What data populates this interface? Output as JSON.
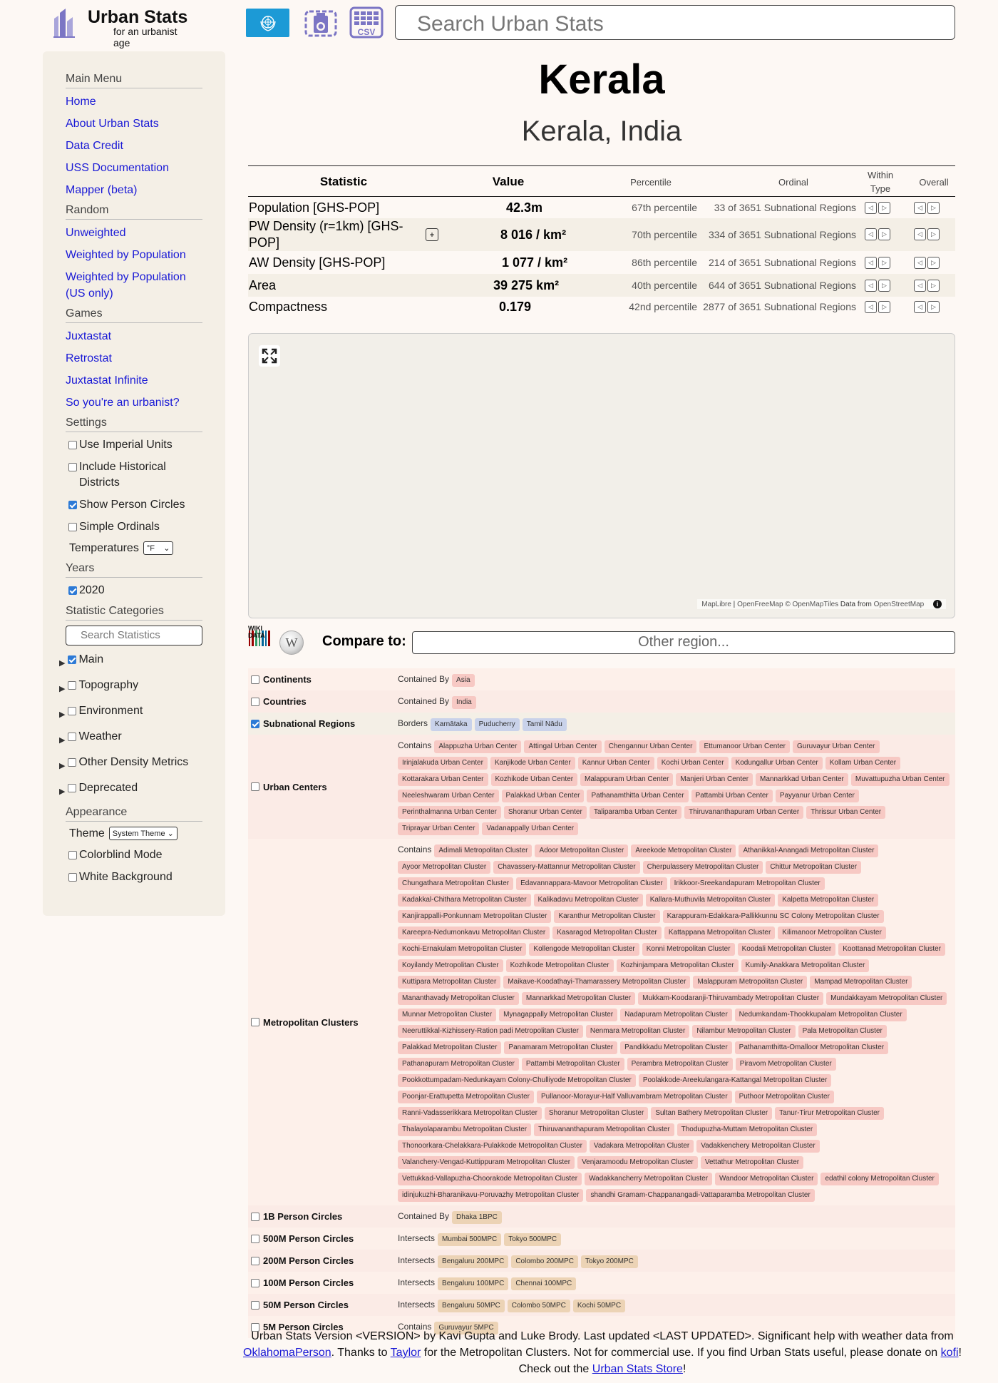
{
  "header": {
    "logo_title": "Urban Stats",
    "logo_subtitle": "for an urbanist age",
    "search_placeholder": "Search Urban Stats",
    "csv_label": "CSV",
    "accent": "#1c9ad6",
    "icon_color": "#7b75c4"
  },
  "sidebar": {
    "main_menu": {
      "title": "Main Menu",
      "items": [
        "Home",
        "About Urban Stats",
        "Data Credit",
        "USS Documentation",
        "Mapper (beta)"
      ]
    },
    "random": {
      "title": "Random",
      "items": [
        "Unweighted",
        "Weighted by Population",
        "Weighted by Population (US only)"
      ]
    },
    "games": {
      "title": "Games",
      "items": [
        "Juxtastat",
        "Retrostat",
        "Juxtastat Infinite",
        "So you're an urbanist?"
      ]
    },
    "settings": {
      "title": "Settings",
      "checks": [
        {
          "label": "Use Imperial Units",
          "checked": false
        },
        {
          "label": "Include Historical Districts",
          "checked": false
        },
        {
          "label": "Show Person Circles",
          "checked": true
        },
        {
          "label": "Simple Ordinals",
          "checked": false
        }
      ],
      "temperatures_label": "Temperatures",
      "temperatures_value": "°F"
    },
    "years": {
      "title": "Years",
      "checks": [
        {
          "label": "2020",
          "checked": true
        }
      ]
    },
    "categories": {
      "title": "Statistic Categories",
      "search_placeholder": "Search Statistics",
      "items": [
        {
          "label": "Main",
          "checked": true
        },
        {
          "label": "Topography",
          "checked": false
        },
        {
          "label": "Environment",
          "checked": false
        },
        {
          "label": "Weather",
          "checked": false
        },
        {
          "label": "Other Density Metrics",
          "checked": false
        },
        {
          "label": "Deprecated",
          "checked": false
        }
      ]
    },
    "appearance": {
      "title": "Appearance",
      "theme_label": "Theme",
      "theme_value": "System Theme",
      "checks": [
        {
          "label": "Colorblind Mode",
          "checked": false
        },
        {
          "label": "White Background",
          "checked": false
        }
      ]
    }
  },
  "page": {
    "title": "Kerala",
    "subtitle": "Kerala, India"
  },
  "stats": {
    "headers": {
      "statistic": "Statistic",
      "value": "Value",
      "percentile": "Percentile",
      "ordinal": "Ordinal",
      "within_type": "Within Type",
      "overall": "Overall"
    },
    "rows": [
      {
        "name": "Population [GHS-POP]",
        "value": "42.3m",
        "percentile": "67th percentile",
        "ordinal": "33 of 3651 Subnational Regions"
      },
      {
        "name": "PW Density (r=1km) [GHS-POP]",
        "value": "8 016 / km²",
        "percentile": "70th percentile",
        "ordinal": "334 of 3651 Subnational Regions"
      },
      {
        "name": "AW Density [GHS-POP]",
        "value": "1 077 / km²",
        "percentile": "86th percentile",
        "ordinal": "214 of 3651 Subnational Regions"
      },
      {
        "name": "Area",
        "value": "39 275 km²",
        "percentile": "40th percentile",
        "ordinal": "644 of 3651 Subnational Regions"
      },
      {
        "name": "Compactness",
        "value": "0.179",
        "percentile": "42nd percentile",
        "ordinal": "2877 of 3651 Subnational Regions"
      }
    ]
  },
  "map": {
    "attribution_maplibre": "MapLibre",
    "attribution_sep": " | ",
    "attribution_ofm": "OpenFreeMap",
    "attribution_omt": " © OpenMapTiles",
    "attribution_data": " Data from ",
    "attribution_osm": "OpenStreetMap"
  },
  "compare": {
    "wiki_label": "WIKI DATA",
    "label": "Compare to:",
    "placeholder": "Other region..."
  },
  "related": [
    {
      "type": "Continents",
      "checked": false,
      "groups": [
        {
          "kind": "Contained By",
          "color": "red",
          "items": [
            "Asia"
          ]
        }
      ]
    },
    {
      "type": "Countries",
      "checked": false,
      "groups": [
        {
          "kind": "Contained By",
          "color": "red",
          "items": [
            "India"
          ]
        }
      ]
    },
    {
      "type": "Subnational Regions",
      "checked": true,
      "groups": [
        {
          "kind": "Borders",
          "color": "blue",
          "items": [
            "Karnātaka",
            "Puducherry",
            "Tamil Nādu"
          ]
        }
      ]
    },
    {
      "type": "Urban Centers",
      "checked": false,
      "groups": [
        {
          "kind": "Contains",
          "color": "red",
          "items": [
            "Alappuzha Urban Center",
            "Attingal Urban Center",
            "Chengannur Urban Center",
            "Ettumanoor Urban Center",
            "Guruvayur Urban Center",
            "Irinjalakuda Urban Center",
            "Kanjikode Urban Center",
            "Kannur Urban Center",
            "Kochi Urban Center",
            "Kodungallur Urban Center",
            "Kollam Urban Center",
            "Kottarakara Urban Center",
            "Kozhikode Urban Center",
            "Malappuram Urban Center",
            "Manjeri Urban Center",
            "Mannarkkad Urban Center",
            "Muvattupuzha Urban Center",
            "Neeleshwaram Urban Center",
            "Palakkad Urban Center",
            "Pathanamthitta Urban Center",
            "Pattambi Urban Center",
            "Payyanur Urban Center",
            "Perinthalmanna Urban Center",
            "Shoranur Urban Center",
            "Taliparamba Urban Center",
            "Thiruvananthapuram Urban Center",
            "Thrissur Urban Center",
            "Triprayar Urban Center",
            "Vadanappally Urban Center"
          ]
        }
      ]
    },
    {
      "type": "Metropolitan Clusters",
      "checked": false,
      "groups": [
        {
          "kind": "Contains",
          "color": "red",
          "items": [
            "Adimali Metropolitan Cluster",
            "Adoor Metropolitan Cluster",
            "Areekode Metropolitan Cluster",
            "Athanikkal-Anangadi Metropolitan Cluster",
            "Ayoor Metropolitan Cluster",
            "Chavassery-Mattannur Metropolitan Cluster",
            "Cherpulassery Metropolitan Cluster",
            "Chittur Metropolitan Cluster",
            "Chungathara Metropolitan Cluster",
            "Edavannappara-Mavoor Metropolitan Cluster",
            "Irikkoor-Sreekandapuram Metropolitan Cluster",
            "Kadakkal-Chithara Metropolitan Cluster",
            "Kalikadavu Metropolitan Cluster",
            "Kallara-Muthuvila Metropolitan Cluster",
            "Kalpetta Metropolitan Cluster",
            "Kanjirappalli-Ponkunnam Metropolitan Cluster",
            "Karanthur Metropolitan Cluster",
            "Karappuram-Edakkara-Pallikkunnu SC Colony Metropolitan Cluster",
            "Kareepra-Nedumonkavu Metropolitan Cluster",
            "Kasaragod Metropolitan Cluster",
            "Kattappana Metropolitan Cluster",
            "Kilimanoor Metropolitan Cluster",
            "Kochi-Ernakulam Metropolitan Cluster",
            "Kollengode Metropolitan Cluster",
            "Konni Metropolitan Cluster",
            "Koodali Metropolitan Cluster",
            "Koottanad Metropolitan Cluster",
            "Koyilandy Metropolitan Cluster",
            "Kozhikode Metropolitan Cluster",
            "Kozhinjampara Metropolitan Cluster",
            "Kumily-Anakkara Metropolitan Cluster",
            "Kuttipara Metropolitan Cluster",
            "Maikave-Koodathayi-Thamarassery Metropolitan Cluster",
            "Malappuram Metropolitan Cluster",
            "Mampad Metropolitan Cluster",
            "Mananthavady Metropolitan Cluster",
            "Mannarkkad Metropolitan Cluster",
            "Mukkam-Koodaranji-Thiruvambady Metropolitan Cluster",
            "Mundakkayam Metropolitan Cluster",
            "Munnar Metropolitan Cluster",
            "Mynagappally Metropolitan Cluster",
            "Nadapuram Metropolitan Cluster",
            "Nedumkandam-Thookkupalam Metropolitan Cluster",
            "Neeruttikkal-Kizhissery-Ration padi Metropolitan Cluster",
            "Nenmara Metropolitan Cluster",
            "Nilambur Metropolitan Cluster",
            "Pala Metropolitan Cluster",
            "Palakkad Metropolitan Cluster",
            "Panamaram Metropolitan Cluster",
            "Pandikkadu Metropolitan Cluster",
            "Pathanamthitta-Omalloor Metropolitan Cluster",
            "Pathanapuram Metropolitan Cluster",
            "Pattambi Metropolitan Cluster",
            "Perambra Metropolitan Cluster",
            "Piravom Metropolitan Cluster",
            "Pookkottumpadam-Nedunkayam Colony-Chulliyode Metropolitan Cluster",
            "Poolakkode-Areekulangara-Kattangal Metropolitan Cluster",
            "Poonjar-Erattupetta Metropolitan Cluster",
            "Pullanoor-Morayur-Half Valluvambram Metropolitan Cluster",
            "Puthoor Metropolitan Cluster",
            "Ranni-Vadasserikkara Metropolitan Cluster",
            "Shoranur Metropolitan Cluster",
            "Sultan Bathery Metropolitan Cluster",
            "Tanur-Tirur Metropolitan Cluster",
            "Thalayolaparambu Metropolitan Cluster",
            "Thiruvananthapuram Metropolitan Cluster",
            "Thodupuzha-Muttam Metropolitan Cluster",
            "Thonoorkara-Chelakkara-Pulakkode Metropolitan Cluster",
            "Vadakara Metropolitan Cluster",
            "Vadakkenchery Metropolitan Cluster",
            "Valanchery-Vengad-Kuttippuram Metropolitan Cluster",
            "Venjaramoodu Metropolitan Cluster",
            "Vettathur Metropolitan Cluster",
            "Vettukkad-Vallapuzha-Choorakode Metropolitan Cluster",
            "Wadakkancherry Metropolitan Cluster",
            "Wandoor Metropolitan Cluster",
            "edathil colony Metropolitan Cluster",
            "idinjukuzhi-Bharanikavu-Poruvazhy Metropolitan Cluster",
            "shandhi Gramam-Chappanangadi-Vattaparamba Metropolitan Cluster"
          ]
        }
      ]
    },
    {
      "type": "1B Person Circles",
      "checked": false,
      "groups": [
        {
          "kind": "Contained By",
          "color": "tan",
          "items": [
            "Dhaka 1BPC"
          ]
        }
      ]
    },
    {
      "type": "500M Person Circles",
      "checked": false,
      "groups": [
        {
          "kind": "Intersects",
          "color": "tan",
          "items": [
            "Mumbai 500MPC",
            "Tokyo 500MPC"
          ]
        }
      ]
    },
    {
      "type": "200M Person Circles",
      "checked": false,
      "groups": [
        {
          "kind": "Intersects",
          "color": "tan",
          "items": [
            "Bengaluru 200MPC",
            "Colombo 200MPC",
            "Tokyo 200MPC"
          ]
        }
      ]
    },
    {
      "type": "100M Person Circles",
      "checked": false,
      "groups": [
        {
          "kind": "Intersects",
          "color": "tan",
          "items": [
            "Bengaluru 100MPC",
            "Chennai 100MPC"
          ]
        }
      ]
    },
    {
      "type": "50M Person Circles",
      "checked": false,
      "groups": [
        {
          "kind": "Intersects",
          "color": "tan",
          "items": [
            "Bengaluru 50MPC",
            "Colombo 50MPC",
            "Kochi 50MPC"
          ]
        }
      ]
    },
    {
      "type": "5M Person Circles",
      "checked": false,
      "groups": [
        {
          "kind": "Contains",
          "color": "tan",
          "items": [
            "Guruvayur 5MPC"
          ]
        }
      ]
    }
  ],
  "footer": {
    "t1": "Urban Stats Version <VERSION> by Kavi Gupta and Luke Brody. Last updated <LAST UPDATED>. Significant help with weather data from ",
    "l1": "OklahomaPerson",
    "t2": ". Thanks to ",
    "l2": "Taylor",
    "t3": " for the Metropolitan Clusters. Not for commercial use. If you find Urban Stats useful, please donate on ",
    "l3": "kofi",
    "t4": "! Check out the ",
    "l4": "Urban Stats Store",
    "t5": "!"
  }
}
